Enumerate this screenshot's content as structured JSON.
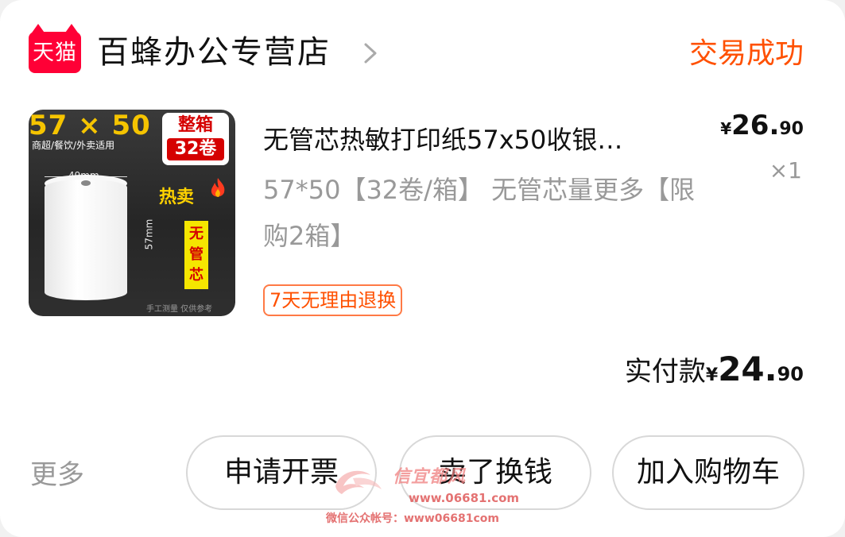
{
  "shop": {
    "logo_text": "天猫",
    "name": "百蜂办公专营店",
    "chevron_icon": "chevron-right-icon"
  },
  "order": {
    "status": "交易成功",
    "status_color": "#ff5000"
  },
  "product": {
    "image_text": {
      "size": "57 × 50",
      "subtitle": "商超/餐饮/外卖适用",
      "box_line1": "整箱",
      "box_line2": "32卷",
      "width_dim": "49mm",
      "height_dim": "57mm",
      "hot": "热卖",
      "no_core": "无管芯",
      "footer": "手工测量 仅供参考"
    },
    "title": "无管芯热敏打印纸57x50收银…",
    "sku": "57*50【32卷/箱】 无管芯量更多【限购2箱】",
    "return_tag": "7天无理由退换",
    "price_symbol": "¥",
    "price_int": "26.",
    "price_dec": "90",
    "quantity": "×1"
  },
  "payment": {
    "label": "实付款",
    "symbol": "¥",
    "amount_int": "24.",
    "amount_dec": "90"
  },
  "actions": {
    "more": "更多",
    "invoice": "申请开票",
    "resell": "卖了换钱",
    "cart": "加入购物车"
  },
  "watermark": {
    "line1": "信宜都风",
    "line2": "www.06681.com",
    "line3": "微信公众帐号：www06681com"
  }
}
